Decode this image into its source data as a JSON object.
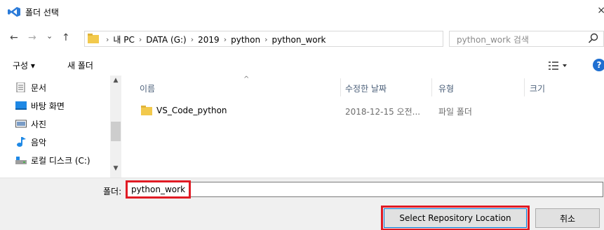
{
  "window": {
    "title": "폴더 선택",
    "close_glyph": "×"
  },
  "navigation": {
    "back_glyph": "←",
    "forward_glyph": "→",
    "recent_glyph": "⌄",
    "up_glyph": "↑",
    "breadcrumbs": [
      "내 PC",
      "DATA (G:)",
      "2019",
      "python",
      "python_work"
    ],
    "separator_glyph": "›",
    "dropdown_glyph": "⌄",
    "refresh_glyph": "↻",
    "search_placeholder": "python_work 검색"
  },
  "toolbar": {
    "organize_label": "구성 ▾",
    "new_folder_label": "새 폴더",
    "view_dropdown_glyph": "▾",
    "help_glyph": "?"
  },
  "sidebar": {
    "items": [
      {
        "label": "문서",
        "icon": "document-icon"
      },
      {
        "label": "바탕 화면",
        "icon": "desktop-icon"
      },
      {
        "label": "사진",
        "icon": "pictures-icon"
      },
      {
        "label": "음악",
        "icon": "music-icon"
      },
      {
        "label": "로컬 디스크 (C:)",
        "icon": "drive-icon"
      }
    ],
    "scroll_up_glyph": "▲",
    "scroll_down_glyph": "▼"
  },
  "file_list": {
    "sort_glyph": "^",
    "columns": [
      "이름",
      "수정한 날짜",
      "유형",
      "크기"
    ],
    "rows": [
      {
        "name": "VS_Code_python",
        "modified": "2018-12-15 오전...",
        "type": "파일 폴더",
        "size": ""
      }
    ]
  },
  "footer": {
    "folder_label": "폴더:",
    "folder_value": "python_work",
    "select_button_label": "Select Repository Location",
    "cancel_button_label": "취소"
  },
  "colors": {
    "highlight_box": "#e01b24",
    "folder_yellow": "#f2c94c",
    "accent_blue": "#0078d7"
  }
}
